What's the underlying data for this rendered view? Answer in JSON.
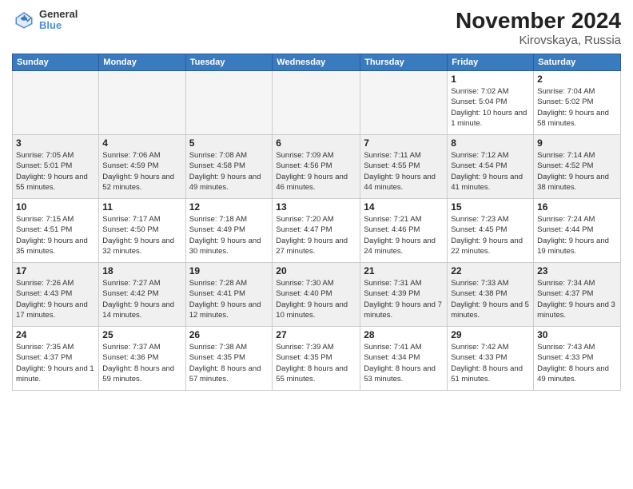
{
  "header": {
    "logo": {
      "general": "General",
      "blue": "Blue"
    },
    "title": "November 2024",
    "subtitle": "Kirovskaya, Russia"
  },
  "weekdays": [
    "Sunday",
    "Monday",
    "Tuesday",
    "Wednesday",
    "Thursday",
    "Friday",
    "Saturday"
  ],
  "weeks": [
    [
      {
        "day": "",
        "info": ""
      },
      {
        "day": "",
        "info": ""
      },
      {
        "day": "",
        "info": ""
      },
      {
        "day": "",
        "info": ""
      },
      {
        "day": "",
        "info": ""
      },
      {
        "day": "1",
        "info": "Sunrise: 7:02 AM\nSunset: 5:04 PM\nDaylight: 10 hours and 1 minute."
      },
      {
        "day": "2",
        "info": "Sunrise: 7:04 AM\nSunset: 5:02 PM\nDaylight: 9 hours and 58 minutes."
      }
    ],
    [
      {
        "day": "3",
        "info": "Sunrise: 7:05 AM\nSunset: 5:01 PM\nDaylight: 9 hours and 55 minutes."
      },
      {
        "day": "4",
        "info": "Sunrise: 7:06 AM\nSunset: 4:59 PM\nDaylight: 9 hours and 52 minutes."
      },
      {
        "day": "5",
        "info": "Sunrise: 7:08 AM\nSunset: 4:58 PM\nDaylight: 9 hours and 49 minutes."
      },
      {
        "day": "6",
        "info": "Sunrise: 7:09 AM\nSunset: 4:56 PM\nDaylight: 9 hours and 46 minutes."
      },
      {
        "day": "7",
        "info": "Sunrise: 7:11 AM\nSunset: 4:55 PM\nDaylight: 9 hours and 44 minutes."
      },
      {
        "day": "8",
        "info": "Sunrise: 7:12 AM\nSunset: 4:54 PM\nDaylight: 9 hours and 41 minutes."
      },
      {
        "day": "9",
        "info": "Sunrise: 7:14 AM\nSunset: 4:52 PM\nDaylight: 9 hours and 38 minutes."
      }
    ],
    [
      {
        "day": "10",
        "info": "Sunrise: 7:15 AM\nSunset: 4:51 PM\nDaylight: 9 hours and 35 minutes."
      },
      {
        "day": "11",
        "info": "Sunrise: 7:17 AM\nSunset: 4:50 PM\nDaylight: 9 hours and 32 minutes."
      },
      {
        "day": "12",
        "info": "Sunrise: 7:18 AM\nSunset: 4:49 PM\nDaylight: 9 hours and 30 minutes."
      },
      {
        "day": "13",
        "info": "Sunrise: 7:20 AM\nSunset: 4:47 PM\nDaylight: 9 hours and 27 minutes."
      },
      {
        "day": "14",
        "info": "Sunrise: 7:21 AM\nSunset: 4:46 PM\nDaylight: 9 hours and 24 minutes."
      },
      {
        "day": "15",
        "info": "Sunrise: 7:23 AM\nSunset: 4:45 PM\nDaylight: 9 hours and 22 minutes."
      },
      {
        "day": "16",
        "info": "Sunrise: 7:24 AM\nSunset: 4:44 PM\nDaylight: 9 hours and 19 minutes."
      }
    ],
    [
      {
        "day": "17",
        "info": "Sunrise: 7:26 AM\nSunset: 4:43 PM\nDaylight: 9 hours and 17 minutes."
      },
      {
        "day": "18",
        "info": "Sunrise: 7:27 AM\nSunset: 4:42 PM\nDaylight: 9 hours and 14 minutes."
      },
      {
        "day": "19",
        "info": "Sunrise: 7:28 AM\nSunset: 4:41 PM\nDaylight: 9 hours and 12 minutes."
      },
      {
        "day": "20",
        "info": "Sunrise: 7:30 AM\nSunset: 4:40 PM\nDaylight: 9 hours and 10 minutes."
      },
      {
        "day": "21",
        "info": "Sunrise: 7:31 AM\nSunset: 4:39 PM\nDaylight: 9 hours and 7 minutes."
      },
      {
        "day": "22",
        "info": "Sunrise: 7:33 AM\nSunset: 4:38 PM\nDaylight: 9 hours and 5 minutes."
      },
      {
        "day": "23",
        "info": "Sunrise: 7:34 AM\nSunset: 4:37 PM\nDaylight: 9 hours and 3 minutes."
      }
    ],
    [
      {
        "day": "24",
        "info": "Sunrise: 7:35 AM\nSunset: 4:37 PM\nDaylight: 9 hours and 1 minute."
      },
      {
        "day": "25",
        "info": "Sunrise: 7:37 AM\nSunset: 4:36 PM\nDaylight: 8 hours and 59 minutes."
      },
      {
        "day": "26",
        "info": "Sunrise: 7:38 AM\nSunset: 4:35 PM\nDaylight: 8 hours and 57 minutes."
      },
      {
        "day": "27",
        "info": "Sunrise: 7:39 AM\nSunset: 4:35 PM\nDaylight: 8 hours and 55 minutes."
      },
      {
        "day": "28",
        "info": "Sunrise: 7:41 AM\nSunset: 4:34 PM\nDaylight: 8 hours and 53 minutes."
      },
      {
        "day": "29",
        "info": "Sunrise: 7:42 AM\nSunset: 4:33 PM\nDaylight: 8 hours and 51 minutes."
      },
      {
        "day": "30",
        "info": "Sunrise: 7:43 AM\nSunset: 4:33 PM\nDaylight: 8 hours and 49 minutes."
      }
    ]
  ]
}
